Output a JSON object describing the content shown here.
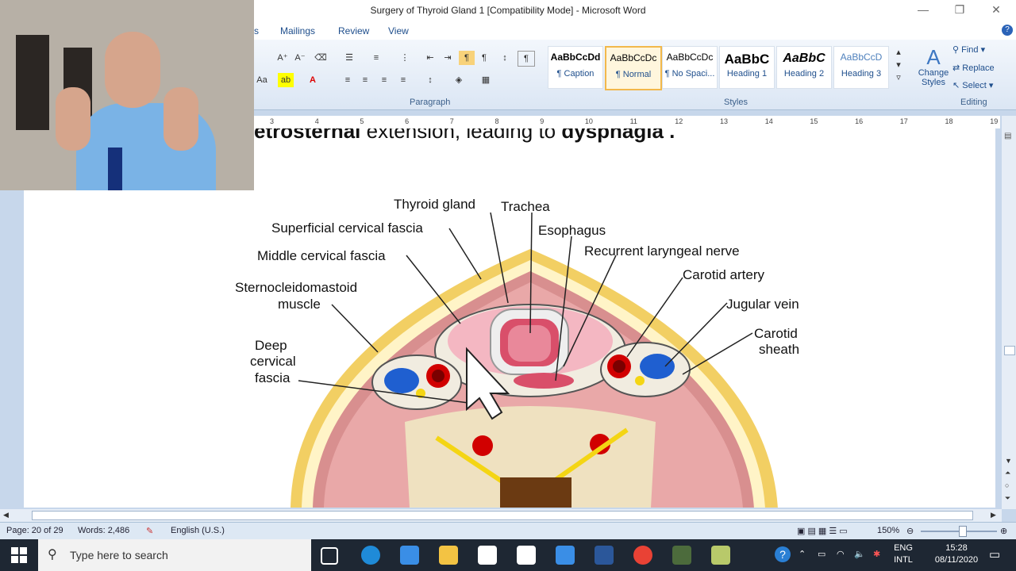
{
  "window": {
    "title": "Surgery of Thyroid Gland 1 [Compatibility Mode] - Microsoft Word"
  },
  "tabs": [
    "s",
    "Mailings",
    "Review",
    "View"
  ],
  "ribbon": {
    "paragraph_label": "Paragraph",
    "styles_label": "Styles",
    "editing_label": "Editing",
    "styles": [
      {
        "preview": "AaBbCcDd",
        "name": "¶ Caption"
      },
      {
        "preview": "AaBbCcDc",
        "name": "¶ Normal"
      },
      {
        "preview": "AaBbCcDc",
        "name": "¶ No Spaci..."
      },
      {
        "preview": "AaBbC",
        "name": "Heading 1"
      },
      {
        "preview": "AaBbC",
        "name": "Heading 2"
      },
      {
        "preview": "AaBbCcD",
        "name": "Heading 3"
      }
    ],
    "change_styles": "Change Styles",
    "find": "Find",
    "replace": "Replace",
    "select": "Select"
  },
  "ruler": [
    "3",
    "4",
    "5",
    "6",
    "7",
    "8",
    "9",
    "10",
    "11",
    "12",
    "13",
    "14",
    "15",
    "16",
    "17",
    "18",
    "19"
  ],
  "document": {
    "heading_bold1": "etrosternal",
    "heading_normal": " extension, leading to ",
    "heading_bold2": "dysphagia",
    "heading_end": " ."
  },
  "diagram": {
    "labels": {
      "thyroid": "Thyroid gland",
      "trachea": "Trachea",
      "esophagus": "Esophagus",
      "superficial": "Superficial cervical fascia",
      "middle": "Middle cervical fascia",
      "recurrent": "Recurrent laryngeal nerve",
      "carotid": "Carotid artery",
      "scm1": "Sternocleidomastoid",
      "scm2": "muscle",
      "jugular": "Jugular vein",
      "sheath1": "Carotid",
      "sheath2": "sheath",
      "deep1": "Deep",
      "deep2": "cervical",
      "deep3": "fascia"
    }
  },
  "status": {
    "page": "Page: 20 of 29",
    "words": "Words: 2,486",
    "language": "English (U.S.)",
    "zoom": "150%"
  },
  "taskbar": {
    "search_placeholder": "Type here to search",
    "lang1": "ENG",
    "lang2": "INTL",
    "time": "15:28",
    "date": "08/11/2020"
  }
}
